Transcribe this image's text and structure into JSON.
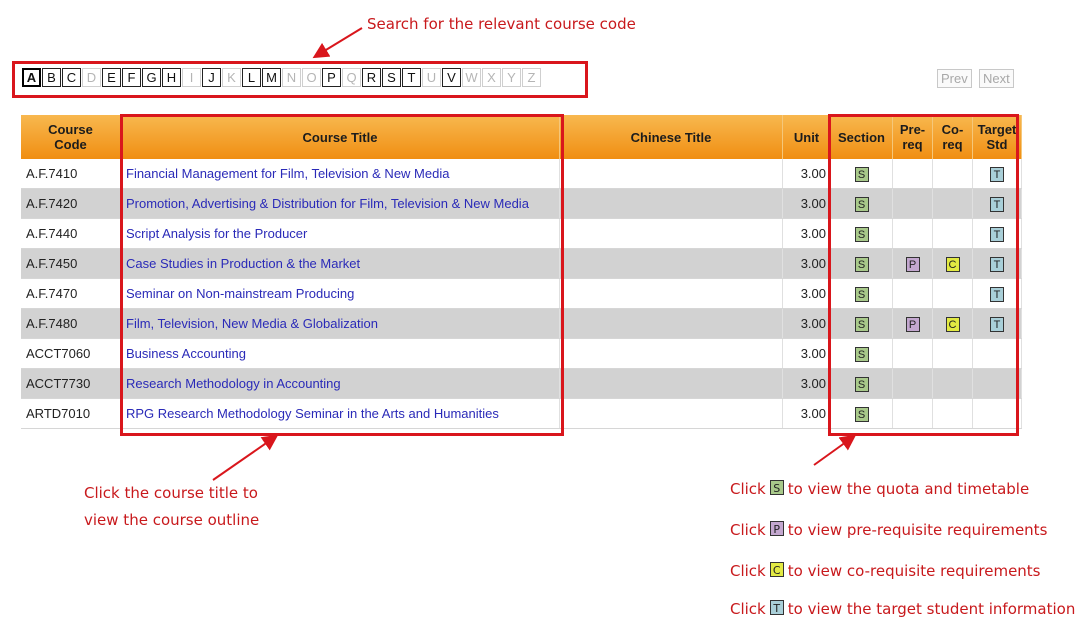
{
  "annotations": {
    "search_hint": "Search for the relevant course code",
    "title_hint_line1": "Click the course title to",
    "title_hint_line2": "view the course outline"
  },
  "alphabet": [
    {
      "letter": "A",
      "state": "selected"
    },
    {
      "letter": "B",
      "state": "on"
    },
    {
      "letter": "C",
      "state": "on"
    },
    {
      "letter": "D",
      "state": "off"
    },
    {
      "letter": "E",
      "state": "on"
    },
    {
      "letter": "F",
      "state": "on"
    },
    {
      "letter": "G",
      "state": "on"
    },
    {
      "letter": "H",
      "state": "on"
    },
    {
      "letter": "I",
      "state": "off"
    },
    {
      "letter": "J",
      "state": "on"
    },
    {
      "letter": "K",
      "state": "off"
    },
    {
      "letter": "L",
      "state": "on"
    },
    {
      "letter": "M",
      "state": "on"
    },
    {
      "letter": "N",
      "state": "off"
    },
    {
      "letter": "O",
      "state": "off"
    },
    {
      "letter": "P",
      "state": "on"
    },
    {
      "letter": "Q",
      "state": "off"
    },
    {
      "letter": "R",
      "state": "on"
    },
    {
      "letter": "S",
      "state": "on"
    },
    {
      "letter": "T",
      "state": "on"
    },
    {
      "letter": "U",
      "state": "off"
    },
    {
      "letter": "V",
      "state": "on"
    },
    {
      "letter": "W",
      "state": "off"
    },
    {
      "letter": "X",
      "state": "off"
    },
    {
      "letter": "Y",
      "state": "off"
    },
    {
      "letter": "Z",
      "state": "off"
    }
  ],
  "pager": {
    "prev": "Prev",
    "next": "Next"
  },
  "table": {
    "headers": {
      "code_line1": "Course",
      "code_line2": "Code",
      "title": "Course Title",
      "chinese": "Chinese Title",
      "unit": "Unit",
      "section": "Section",
      "prereq_line1": "Pre-",
      "prereq_line2": "req",
      "coreq_line1": "Co-",
      "coreq_line2": "req",
      "target_line1": "Target",
      "target_line2": "Std"
    },
    "rows": [
      {
        "code": "A.F.7410",
        "title": "Financial Management for Film, Television & New Media",
        "unit": "3.00",
        "s": true,
        "p": false,
        "c": false,
        "t": true
      },
      {
        "code": "A.F.7420",
        "title": "Promotion, Advertising & Distribution for Film, Television & New Media",
        "unit": "3.00",
        "s": true,
        "p": false,
        "c": false,
        "t": true
      },
      {
        "code": "A.F.7440",
        "title": "Script Analysis for the Producer",
        "unit": "3.00",
        "s": true,
        "p": false,
        "c": false,
        "t": true
      },
      {
        "code": "A.F.7450",
        "title": "Case Studies in Production & the Market",
        "unit": "3.00",
        "s": true,
        "p": true,
        "c": true,
        "t": true
      },
      {
        "code": "A.F.7470",
        "title": "Seminar on Non-mainstream Producing",
        "unit": "3.00",
        "s": true,
        "p": false,
        "c": false,
        "t": true
      },
      {
        "code": "A.F.7480",
        "title": "Film, Television, New Media & Globalization",
        "unit": "3.00",
        "s": true,
        "p": true,
        "c": true,
        "t": true
      },
      {
        "code": "ACCT7060",
        "title": "Business Accounting",
        "unit": "3.00",
        "s": true,
        "p": false,
        "c": false,
        "t": false
      },
      {
        "code": "ACCT7730",
        "title": "Research Methodology in Accounting",
        "unit": "3.00",
        "s": true,
        "p": false,
        "c": false,
        "t": false
      },
      {
        "code": "ARTD7010",
        "title": "RPG Research Methodology Seminar in the Arts and Humanities",
        "unit": "3.00",
        "s": true,
        "p": false,
        "c": false,
        "t": false
      }
    ]
  },
  "badges": {
    "s": "S",
    "p": "P",
    "c": "C",
    "t": "T"
  },
  "legend": [
    {
      "key": "s",
      "before": "Click",
      "after": "to view the quota and timetable"
    },
    {
      "key": "p",
      "before": "Click",
      "after": "to view pre-requisite requirements"
    },
    {
      "key": "c",
      "before": "Click",
      "after": "to view co-requisite requirements"
    },
    {
      "key": "t",
      "before": "Click",
      "after": "to view the target student information"
    }
  ],
  "colors": {
    "accent_red": "#d9161c",
    "header_orange": "#f39b1f",
    "link_blue": "#2a2ab8",
    "row_alt": "#d2d2d2"
  }
}
